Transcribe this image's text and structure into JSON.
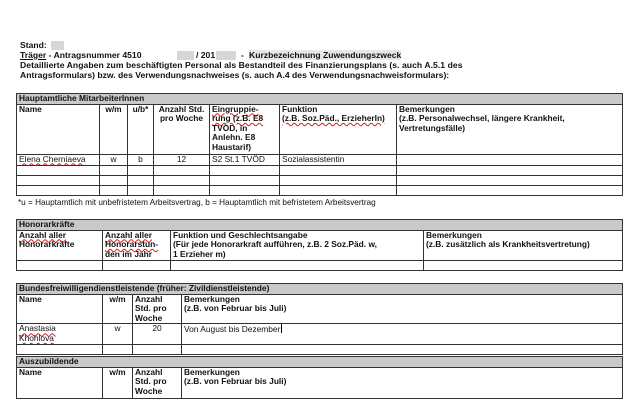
{
  "header": {
    "stand_label": "Stand:",
    "traeger_label": "Träger",
    "antrag_text": "- Antragsnummer 4510",
    "slash_year": "/ 201",
    "kurz_dash": "-",
    "kurz_label": "Kurzbezeichnung Zuwendungszweck",
    "desc_line1": "Detaillierte Angaben zum beschäftigten Personal als Bestandteil des Finanzierungsplans (s. auch A.5.1 des",
    "desc_line2": "Antragsformulars) bzw. des Verwendungsnachweises (s. auch A.4 des Verwendungsnachweisformulars):"
  },
  "hauptamtliche": {
    "section_title": "Hauptamtliche MitarbeiterInnen",
    "headers": {
      "name": "Name",
      "wm": "w/m",
      "ub": "u/b*",
      "anzahl1": "Anzahl Std.",
      "anzahl2": "pro Woche",
      "eing1": "Eingruppie-",
      "eing2": "rung (z.B. E8",
      "eing3": "TVÖD, in",
      "eing4": "Anlehn. E8",
      "eing5": "Haustarif)",
      "funktion1": "Funktion",
      "funktion2": "(z.B. Soz.Päd., ErzieherIn)",
      "bem1": "Bemerkungen",
      "bem2": "(z.B. Personalwechsel, längere Krankheit,",
      "bem3": "Vertretungsfälle)"
    },
    "row1": {
      "name": "Elena Cherniaeva",
      "wm": "w",
      "ub": "b",
      "hours": "12",
      "eing": "S2 St.1 TVÖD",
      "funktion": "Sozialassistentin",
      "bem": ""
    },
    "footnote": "*u = Hauptamtlich mit unbefristetem Arbeitsvertrag, b = Hauptamtlich mit befristetem Arbeitsvertrag"
  },
  "honorar": {
    "section_title": "Honorarkräfte",
    "h1a": "Anzahl aller",
    "h1b": "Honorarkräfte",
    "h2a": "Anzahl aller",
    "h2b": "Honorarstun-",
    "h2c": "den im Jahr",
    "h3a": "Funktion und Geschlechtsangabe",
    "h3b": "(Für jede Honorarkraft aufführen, z.B. 2 Soz.Päd. w,",
    "h3c": "1 Erzieher m)",
    "h4a": "Bemerkungen",
    "h4b": "(z.B. zusätzlich als Krankheitsvertretung)"
  },
  "bfd": {
    "section_title": "Bundesfreiwilligendienstleistende (früher: Zivildienstleistende)",
    "h_name": "Name",
    "h_wm": "w/m",
    "h_anz1": "Anzahl",
    "h_anz2": "Std. pro",
    "h_anz3": "Woche",
    "h_bem1": "Bemerkungen",
    "h_bem2": "(z.B. von Februar bis Juli)",
    "row_name1": "Anastasia",
    "row_name2": "Khohlova",
    "row_wm": "w",
    "row_hours": "20",
    "row_bem": "Von August bis Dezember"
  },
  "azubi": {
    "section_title": "Auszubildende",
    "h_name": "Name",
    "h_wm": "w/m",
    "h_anz1": "Anzahl",
    "h_anz2": "Std. pro",
    "h_anz3": "Woche",
    "h_bem1": "Bemerkungen",
    "h_bem2": "(z.B. von Februar bis Juli)"
  }
}
